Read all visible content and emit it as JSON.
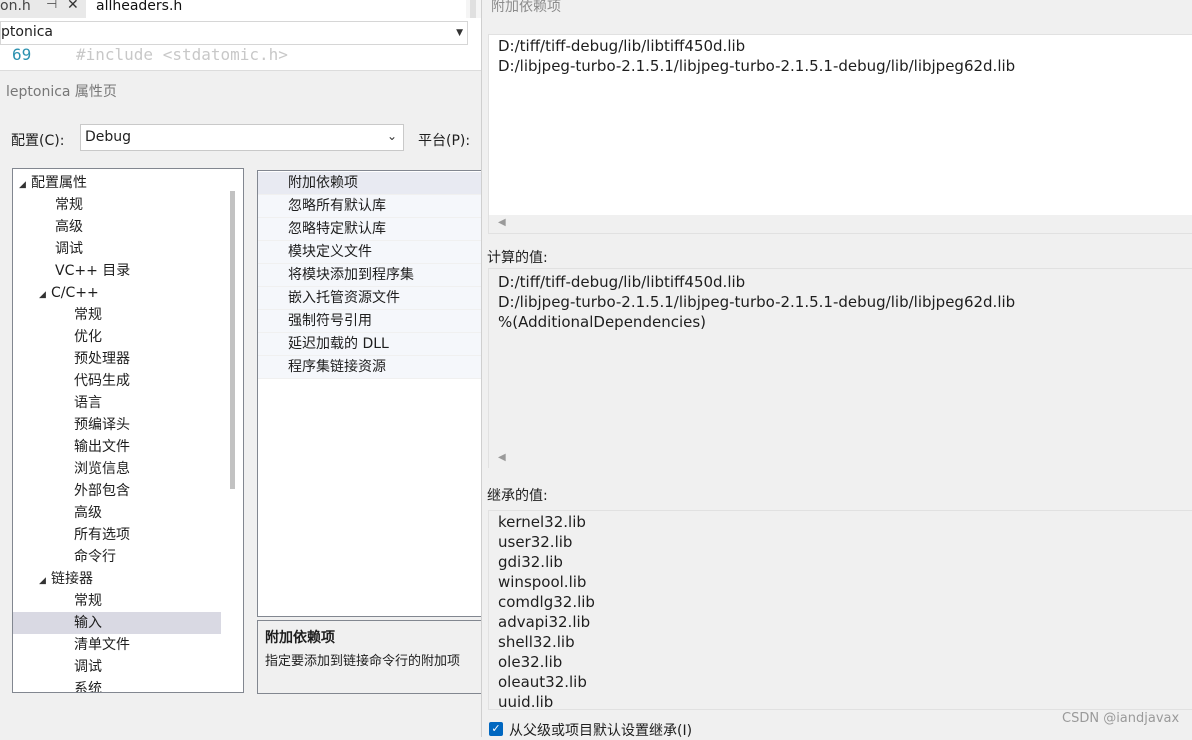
{
  "editor": {
    "tab_inactive": "on.h",
    "tab_active": "allheaders.h",
    "nav_project": "ptonica",
    "line_number": "69",
    "code": "#include <stdatomic.h>"
  },
  "dialog": {
    "title": "leptonica 属性页",
    "config_label": "配置(C):",
    "config_value": "Debug",
    "platform_label": "平台(P):"
  },
  "tree": [
    {
      "label": "配置属性",
      "level": 0,
      "expanded": true
    },
    {
      "label": "常规",
      "level": 1
    },
    {
      "label": "高级",
      "level": 1
    },
    {
      "label": "调试",
      "level": 1
    },
    {
      "label": "VC++ 目录",
      "level": 1
    },
    {
      "label": "C/C++",
      "level": 1,
      "expanded": true
    },
    {
      "label": "常规",
      "level": 2
    },
    {
      "label": "优化",
      "level": 2
    },
    {
      "label": "预处理器",
      "level": 2
    },
    {
      "label": "代码生成",
      "level": 2
    },
    {
      "label": "语言",
      "level": 2
    },
    {
      "label": "预编译头",
      "level": 2
    },
    {
      "label": "输出文件",
      "level": 2
    },
    {
      "label": "浏览信息",
      "level": 2
    },
    {
      "label": "外部包含",
      "level": 2
    },
    {
      "label": "高级",
      "level": 2
    },
    {
      "label": "所有选项",
      "level": 2
    },
    {
      "label": "命令行",
      "level": 2
    },
    {
      "label": "链接器",
      "level": 1,
      "expanded": true
    },
    {
      "label": "常规",
      "level": 2
    },
    {
      "label": "输入",
      "level": 2,
      "selected": true
    },
    {
      "label": "清单文件",
      "level": 2
    },
    {
      "label": "调试",
      "level": 2
    },
    {
      "label": "系统",
      "level": 2
    }
  ],
  "properties": [
    "附加依赖项",
    "忽略所有默认库",
    "忽略特定默认库",
    "模块定义文件",
    "将模块添加到程序集",
    "嵌入托管资源文件",
    "强制符号引用",
    "延迟加载的 DLL",
    "程序集链接资源"
  ],
  "description": {
    "title": "附加依赖项",
    "text": "指定要添加到链接命令行的附加项"
  },
  "popup": {
    "title": "附加依赖项",
    "edit_lines": [
      "D:/tiff/tiff-debug/lib/libtiff450d.lib",
      "D:/libjpeg-turbo-2.1.5.1/libjpeg-turbo-2.1.5.1-debug/lib/libjpeg62d.lib"
    ],
    "calc_label": "计算的值:",
    "calc_lines": [
      "D:/tiff/tiff-debug/lib/libtiff450d.lib",
      "D:/libjpeg-turbo-2.1.5.1/libjpeg-turbo-2.1.5.1-debug/lib/libjpeg62d.lib",
      "%(AdditionalDependencies)"
    ],
    "inherit_label": "继承的值:",
    "inherit_lines": [
      "kernel32.lib",
      "user32.lib",
      "gdi32.lib",
      "winspool.lib",
      "comdlg32.lib",
      "advapi32.lib",
      "shell32.lib",
      "ole32.lib",
      "oleaut32.lib",
      "uuid.lib"
    ],
    "inherit_checkbox": "从父级或项目默认设置继承(I)",
    "inherit_checked": true
  },
  "watermark": "CSDN @iandjavax"
}
